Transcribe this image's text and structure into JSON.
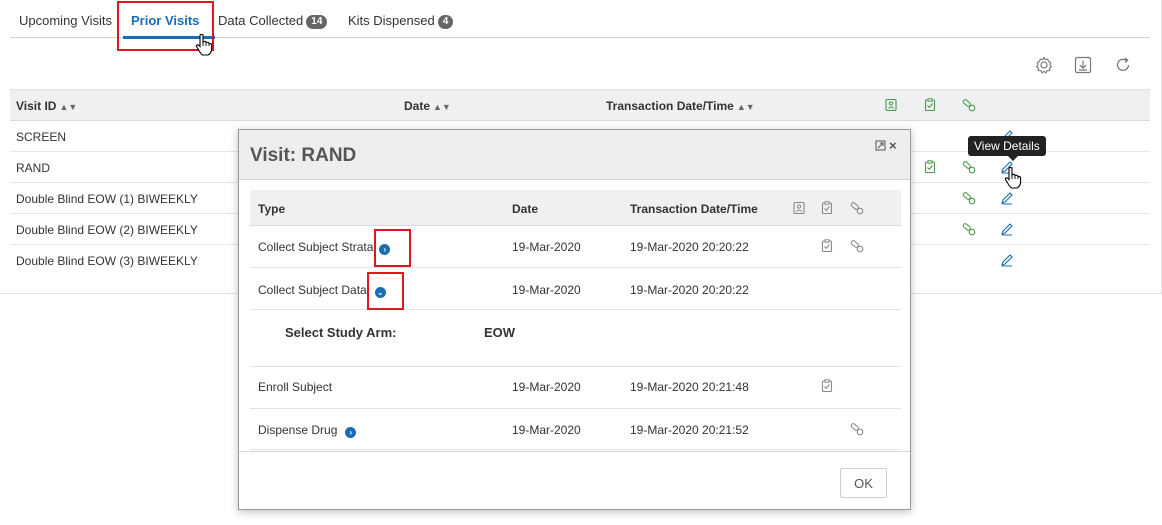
{
  "tabs": [
    {
      "label": "Upcoming Visits",
      "badge": ""
    },
    {
      "label": "Prior Visits",
      "badge": ""
    },
    {
      "label": "Data Collected",
      "badge": "14"
    },
    {
      "label": "Kits Dispensed",
      "badge": "4"
    }
  ],
  "active_tab": "Prior Visits",
  "toolbar": {
    "icons": [
      "settings-icon",
      "download-icon",
      "refresh-icon"
    ]
  },
  "table": {
    "columns": [
      "Visit ID",
      "Date",
      "Transaction Date/Time"
    ],
    "rows": [
      {
        "visit_id": "SCREEN"
      },
      {
        "visit_id": "RAND"
      },
      {
        "visit_id": "Double Blind EOW (1) BIWEEKLY"
      },
      {
        "visit_id": "Double Blind EOW (2) BIWEEKLY"
      },
      {
        "visit_id": "Double Blind EOW (3) BIWEEKLY"
      }
    ]
  },
  "tooltip": "View Details",
  "modal": {
    "title": "Visit: RAND",
    "controls": [
      "expand-icon",
      "close-icon"
    ],
    "columns": [
      "Type",
      "Date",
      "Transaction Date/Time"
    ],
    "rows": [
      {
        "type": "Collect Subject Strata",
        "date": "19-Mar-2020",
        "transaction": "19-Mar-2020 20:20:22",
        "expander": "collapsed"
      },
      {
        "type": "Collect Subject Data",
        "date": "19-Mar-2020",
        "transaction": "19-Mar-2020 20:20:22",
        "expander": "expanded"
      },
      {
        "type": "Enroll Subject",
        "date": "19-Mar-2020",
        "transaction": "19-Mar-2020 20:21:48",
        "expander": "none"
      },
      {
        "type": "Dispense Drug",
        "date": "19-Mar-2020",
        "transaction": "19-Mar-2020 20:21:52",
        "expander": "collapsed"
      }
    ],
    "detail": {
      "label": "Select Study Arm:",
      "value": "EOW"
    },
    "ok_label": "OK"
  },
  "colors": {
    "accent": "#1a6db5",
    "highlight": "#e0161f",
    "icon_green": "#4a9a4a",
    "icon_gray": "#8a8a8a"
  }
}
